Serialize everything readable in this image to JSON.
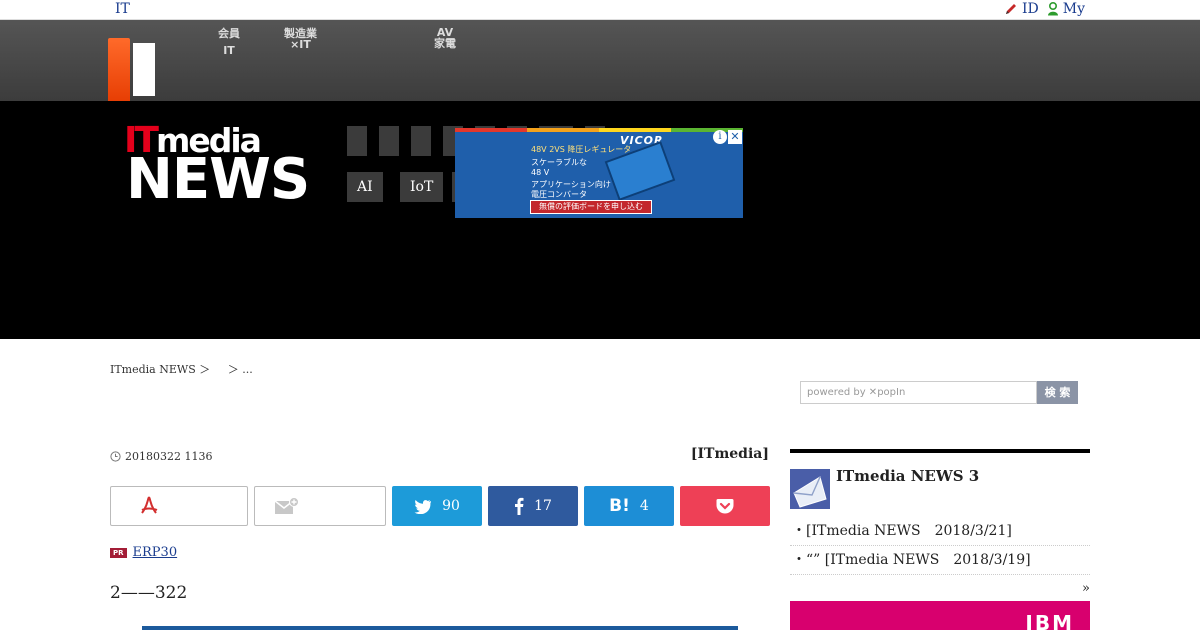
{
  "topbar": {
    "brand": "IT",
    "links": [
      {
        "label": "ID",
        "icon": "pencil-icon"
      },
      {
        "label": "My",
        "icon": "person-icon"
      }
    ]
  },
  "channels": [
    {
      "line1": "会員",
      "line2": "IT"
    },
    {
      "line1": "製造業",
      "line2": "×IT"
    },
    {
      "line1": "AV",
      "line2": "家電"
    }
  ],
  "header": {
    "logo_it": "IT",
    "logo_media": "media",
    "logo_news": "NEWS",
    "tags": [
      "AI",
      "IoT"
    ]
  },
  "ad": {
    "brand": "VICOR",
    "line1": "48V 2VS 降圧レギュレータ",
    "line2": "スケーラブルな",
    "line3": "48 V",
    "line4": "アプリケーション向け",
    "line5": "電圧コンバータ",
    "cta": "無償の評価ボードを申し込む",
    "adchoice": "i",
    "close": "✕"
  },
  "breadcrumb": {
    "root": "ITmedia NEWS ＞",
    "rest": "＞ ..."
  },
  "search": {
    "placeholder": "powered by ✕popIn",
    "button": "検 索"
  },
  "article": {
    "date": "20180322 1136",
    "byline": "[ITmedia]",
    "pr_badge": "PR",
    "pr_link": "ERP30",
    "lede": "2——322"
  },
  "share": {
    "twitter_count": "90",
    "facebook_count": "17",
    "hatena_label": "B!",
    "hatena_count": "4"
  },
  "sidebar": {
    "title": "ITmedia NEWS 3",
    "items": [
      "・[ITmedia NEWS　2018/3/21]",
      "・“” [ITmedia NEWS　2018/3/19]"
    ],
    "more": "»"
  },
  "ibm": "IBM",
  "colors": {
    "twitter": "#1d9bd9",
    "facebook": "#2f5a9e",
    "hatena": "#1d8ed6",
    "pocket": "#ee4056",
    "itmedia_red": "#e4001b"
  }
}
